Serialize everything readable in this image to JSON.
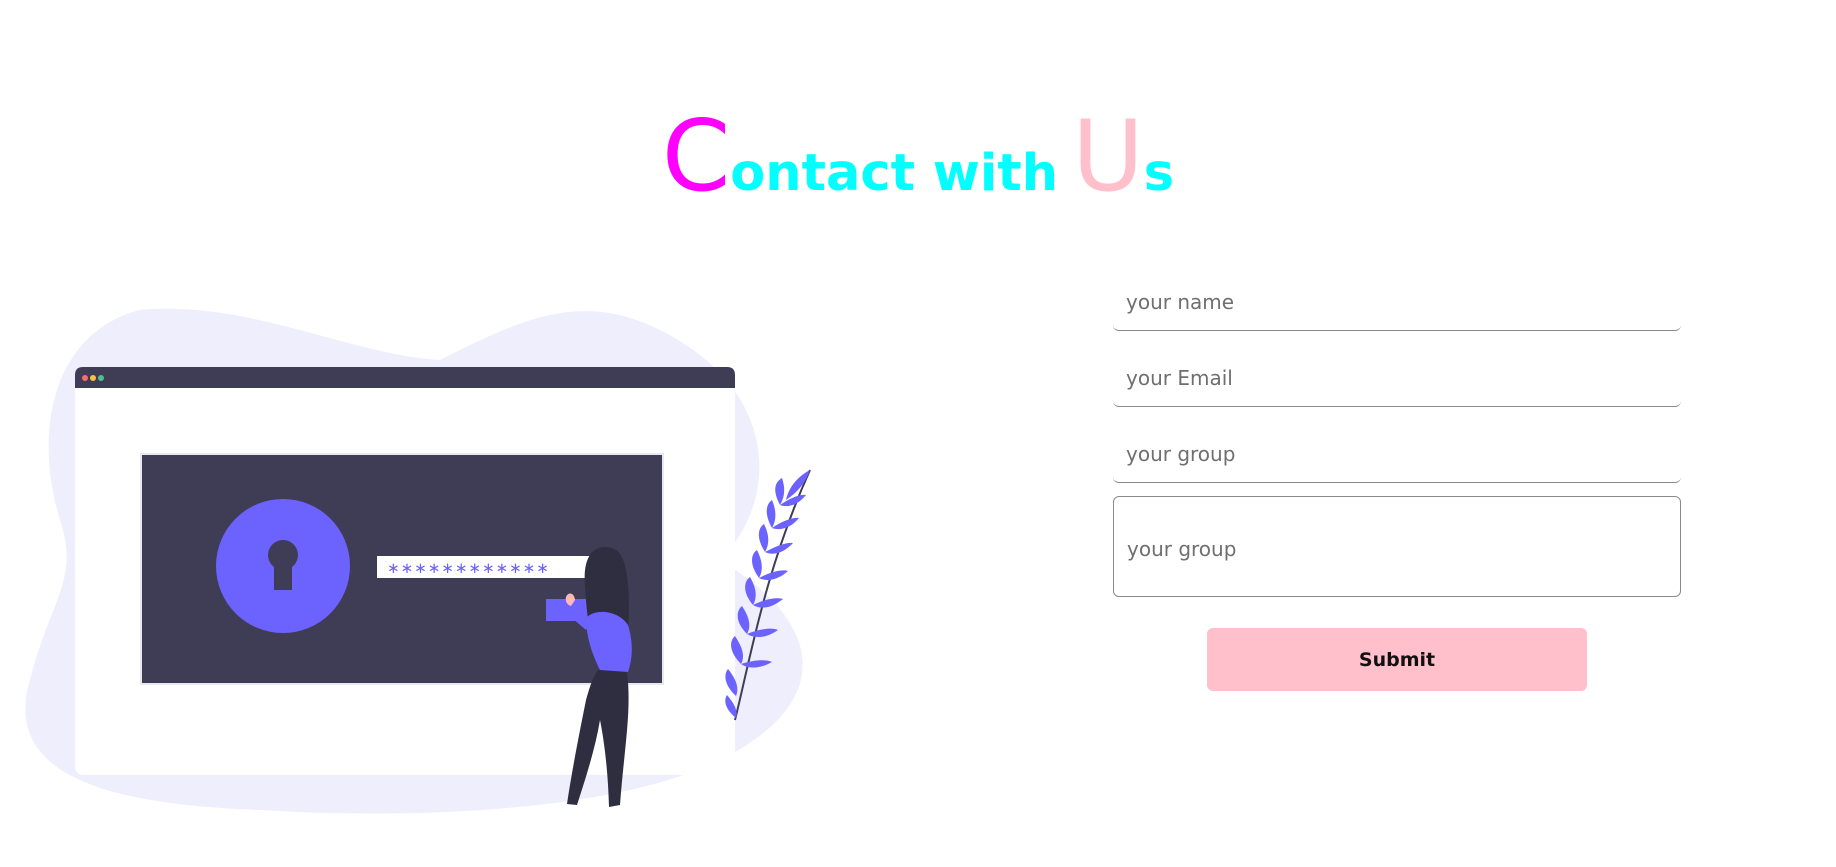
{
  "heading": {
    "part1_big": "C",
    "part2": "ontact with",
    "part3_big": "U",
    "part4": "s",
    "colors": {
      "magenta": "#ff00ff",
      "cyan": "#00ffff",
      "pink": "#ffc0cb"
    }
  },
  "illustration": {
    "password_mask": "∗∗∗∗∗∗∗∗∗∗∗∗",
    "colors": {
      "blob": "#eeeefc",
      "browser_bar": "#3f3d56",
      "panel": "#3f3d56",
      "accent": "#6c63ff",
      "window": "#ffffff"
    }
  },
  "form": {
    "name_placeholder": "your name",
    "email_placeholder": "your Email",
    "group_placeholder": "your group",
    "message_placeholder": "your group",
    "submit_label": "Submit",
    "submit_color": "#ffc0cb"
  }
}
